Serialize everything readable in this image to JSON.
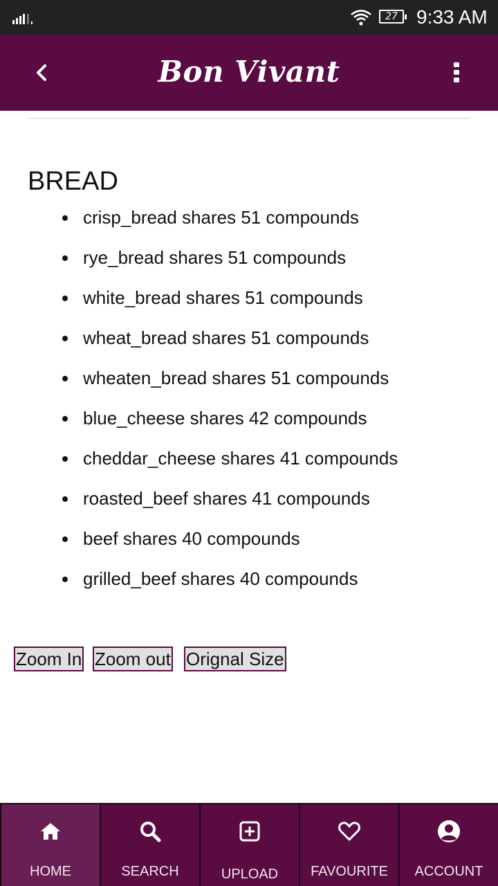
{
  "status_bar": {
    "time": "9:33 AM",
    "battery_level": "27"
  },
  "app_bar": {
    "title": "Bon Vivant"
  },
  "section": {
    "title": "BREAD",
    "items": [
      "crisp_bread shares 51 compounds",
      "rye_bread shares 51 compounds",
      "white_bread shares 51 compounds",
      "wheat_bread shares 51 compounds",
      "wheaten_bread shares 51 compounds",
      "blue_cheese shares 42 compounds",
      "cheddar_cheese shares 41 compounds",
      "roasted_beef shares 41 compounds",
      "beef shares 40 compounds",
      "grilled_beef shares 40 compounds"
    ]
  },
  "zoom": {
    "zoom_in": "Zoom In",
    "zoom_out": "Zoom out",
    "original": "Orignal Size"
  },
  "bottom_nav": {
    "home": "HOME",
    "search": "SEARCH",
    "upload": "UPLOAD",
    "favourite": "FAVOURITE",
    "account": "ACCOUNT"
  }
}
